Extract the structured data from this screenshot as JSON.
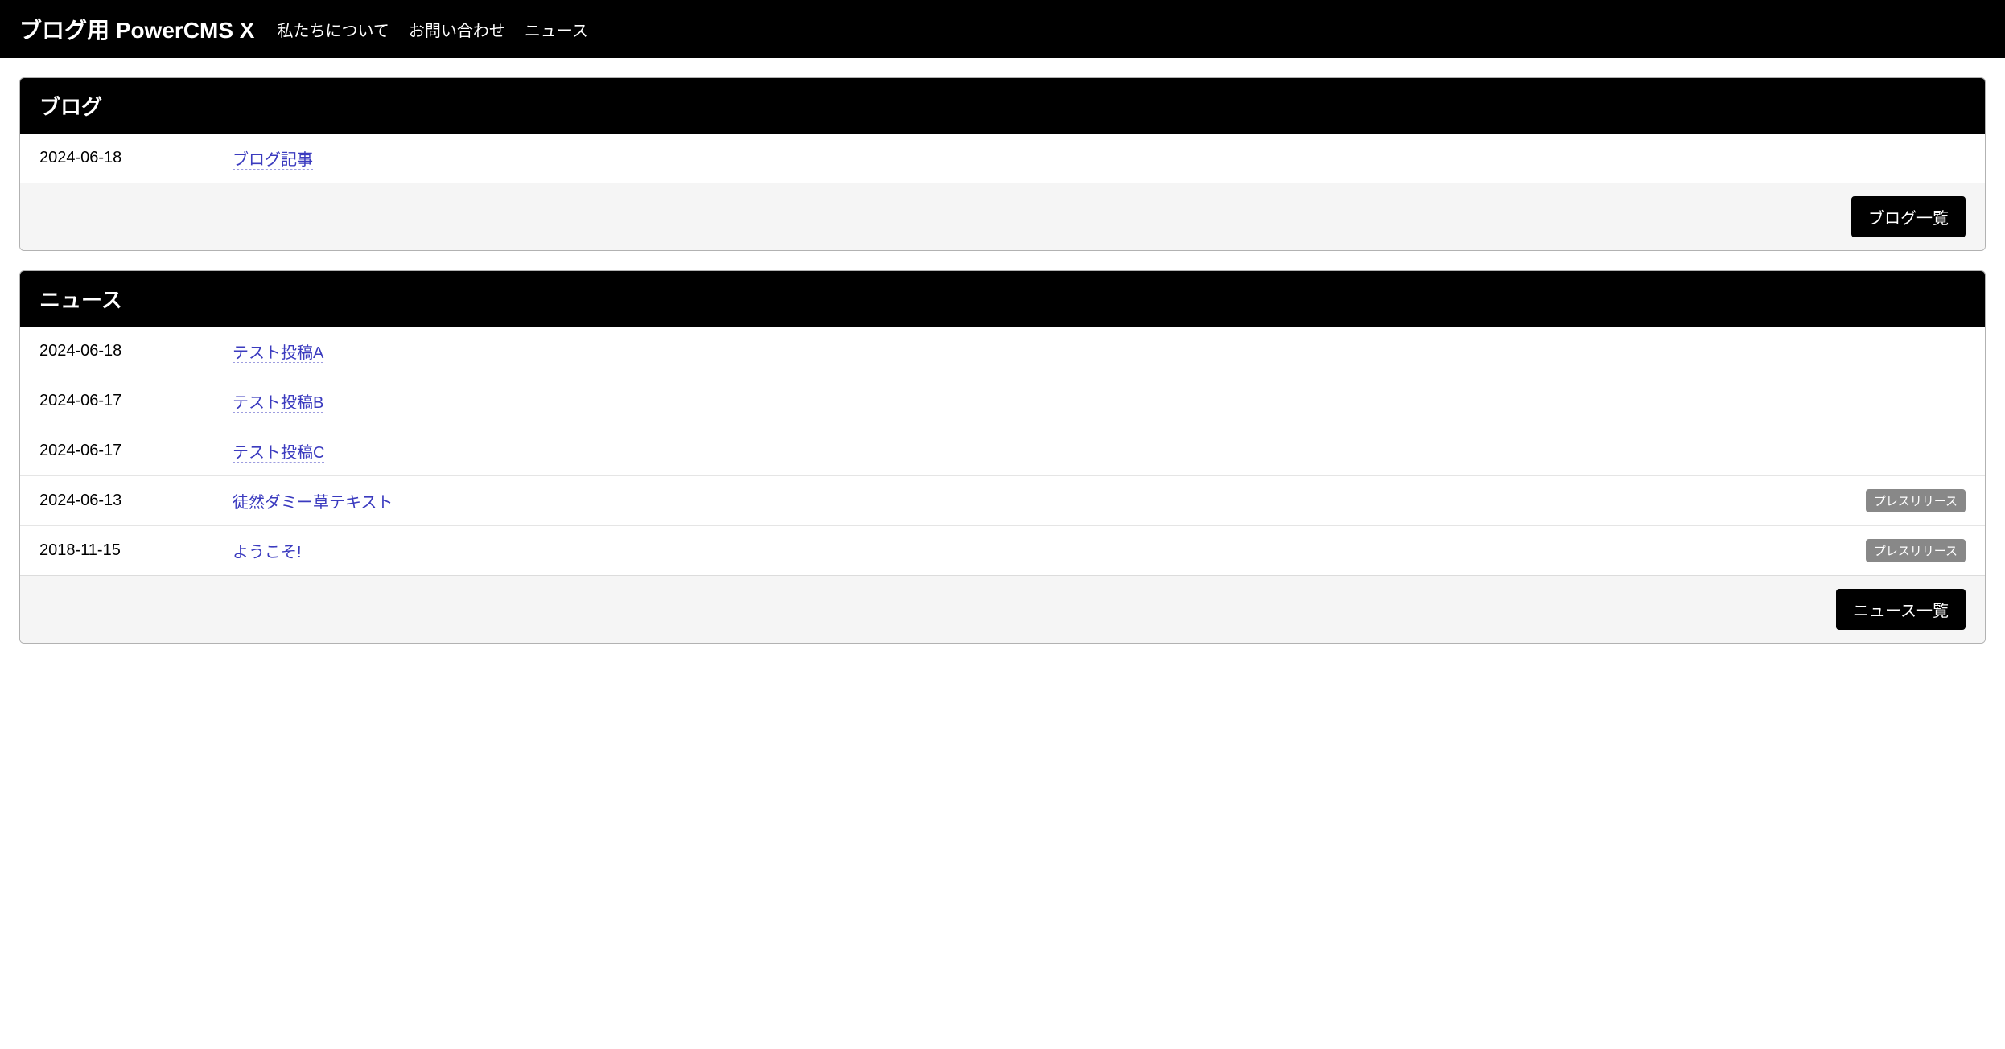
{
  "navbar": {
    "brand": "ブログ用 PowerCMS X",
    "links": [
      {
        "label": "私たちについて"
      },
      {
        "label": "お問い合わせ"
      },
      {
        "label": "ニュース"
      }
    ]
  },
  "panels": [
    {
      "title": "ブログ",
      "items": [
        {
          "date": "2024-06-18",
          "title": "ブログ記事",
          "badge": null
        }
      ],
      "button": "ブログ一覧"
    },
    {
      "title": "ニュース",
      "items": [
        {
          "date": "2024-06-18",
          "title": "テスト投稿A",
          "badge": null
        },
        {
          "date": "2024-06-17",
          "title": "テスト投稿B",
          "badge": null
        },
        {
          "date": "2024-06-17",
          "title": "テスト投稿C",
          "badge": null
        },
        {
          "date": "2024-06-13",
          "title": "徒然ダミー草テキスト",
          "badge": "プレスリリース"
        },
        {
          "date": "2018-11-15",
          "title": "ようこそ!",
          "badge": "プレスリリース"
        }
      ],
      "button": "ニュース一覧"
    }
  ]
}
